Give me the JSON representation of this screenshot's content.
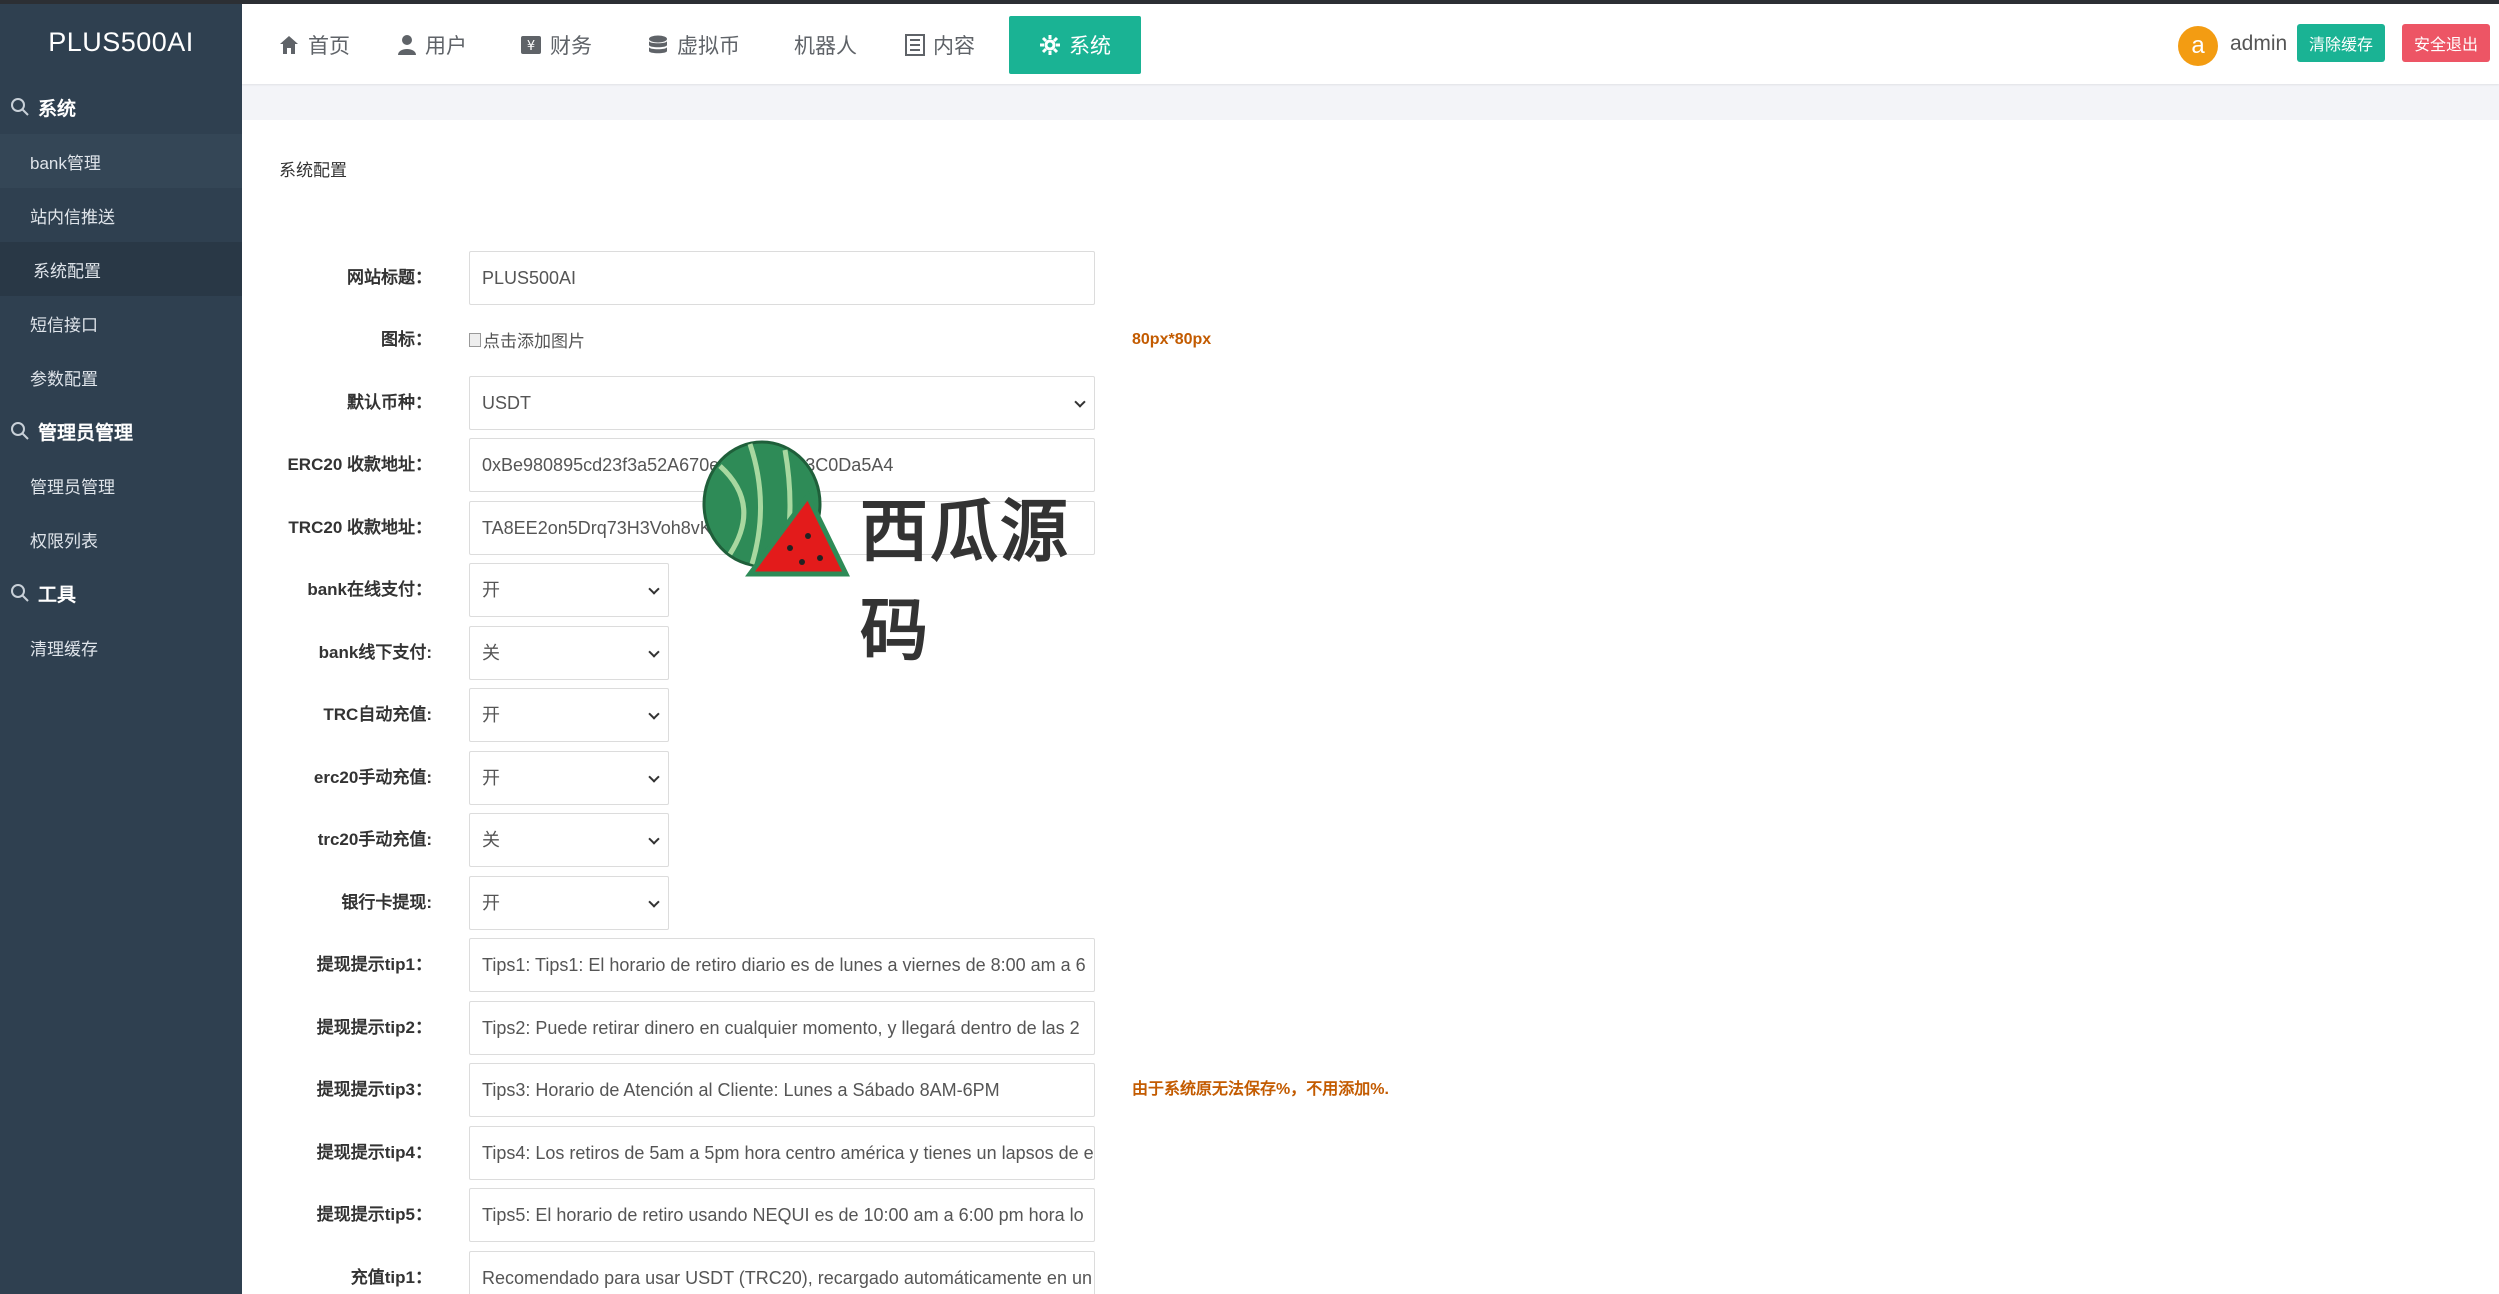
{
  "brand": "PLUS500AI",
  "sidebar": {
    "sections": [
      {
        "title": "系统",
        "items": [
          "bank管理",
          "站内信推送",
          "系统配置",
          "短信接口",
          "参数配置"
        ]
      },
      {
        "title": "管理员管理",
        "items": [
          "管理员管理",
          "权限列表"
        ]
      },
      {
        "title": "工具",
        "items": [
          "清理缓存"
        ]
      }
    ]
  },
  "topnav": {
    "items": [
      {
        "label": "首页",
        "icon": "home-icon"
      },
      {
        "label": "用户",
        "icon": "user-icon"
      },
      {
        "label": "财务",
        "icon": "finance-icon"
      },
      {
        "label": "虚拟币",
        "icon": "database-icon"
      },
      {
        "label": "机器人",
        "icon": ""
      },
      {
        "label": "内容",
        "icon": "document-icon"
      },
      {
        "label": "系统",
        "icon": "gear-icon",
        "active": true
      }
    ],
    "avatar_letter": "a",
    "username": "admin",
    "clear_cache": "清除缓存",
    "logout": "安全退出"
  },
  "page": {
    "title": "系统配置",
    "fields": {
      "site_title": {
        "label": "网站标题：",
        "value": "PLUS500AI"
      },
      "icon": {
        "label": "图标：",
        "alt": "点击添加图片",
        "note": "80px*80px"
      },
      "currency": {
        "label": "默认币种：",
        "value": "USDT"
      },
      "erc20": {
        "label": "ERC20 收款地址：",
        "value": "0xBe980895cd23f3a52A670ecf81d66A23C0Da5A4"
      },
      "trc20": {
        "label": "TRC20 收款地址：",
        "value": "TA8EE2on5Drq73H3Voh8vKq4nbUptUi"
      },
      "bank_online": {
        "label": "bank在线支付：",
        "value": "开"
      },
      "bank_offline": {
        "label": "bank线下支付:",
        "value": "关"
      },
      "trc_auto": {
        "label": "TRC自动充值:",
        "value": "开"
      },
      "erc20_manual": {
        "label": "erc20手动充值:",
        "value": "开"
      },
      "trc20_manual": {
        "label": "trc20手动充值:",
        "value": "关"
      },
      "bank_withdraw": {
        "label": "银行卡提现:",
        "value": "开"
      },
      "tip1": {
        "label": "提现提示tip1：",
        "value": "Tips1: Tips1: El horario de retiro diario es de lunes a viernes de 8:00 am a 6"
      },
      "tip2": {
        "label": "提现提示tip2：",
        "value": "Tips2: Puede retirar dinero en cualquier momento, y llegará dentro de las 2"
      },
      "tip3": {
        "label": "提现提示tip3：",
        "value": "Tips3: Horario de Atención al Cliente: Lunes a Sábado 8AM-6PM",
        "note": "由于系统原无法保存%，不用添加%."
      },
      "tip4": {
        "label": "提现提示tip4：",
        "value": "Tips4: Los retiros de 5am a 5pm hora centro américa y tienes un lapsos de e"
      },
      "tip5": {
        "label": "提现提示tip5：",
        "value": "Tips5: El horario de retiro usando NEQUI es de 10:00 am a 6:00 pm hora lo"
      },
      "recharge_tip1": {
        "label": "充值tip1：",
        "value": "Recomendado para usar USDT (TRC20), recargado automáticamente en un"
      }
    }
  },
  "watermark": {
    "text": "西瓜源码"
  },
  "colors": {
    "sidebar": "#2f4050",
    "accent": "#1ab394",
    "danger": "#ed5565",
    "note": "#c35b00"
  }
}
